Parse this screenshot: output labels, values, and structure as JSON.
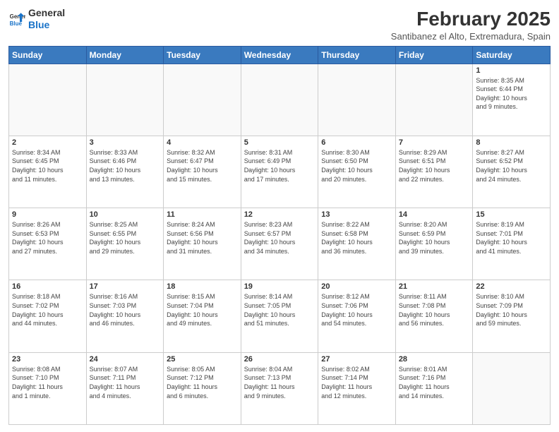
{
  "header": {
    "logo_line1": "General",
    "logo_line2": "Blue",
    "month_title": "February 2025",
    "location": "Santibanez el Alto, Extremadura, Spain"
  },
  "days_of_week": [
    "Sunday",
    "Monday",
    "Tuesday",
    "Wednesday",
    "Thursday",
    "Friday",
    "Saturday"
  ],
  "weeks": [
    [
      {
        "day": "",
        "info": ""
      },
      {
        "day": "",
        "info": ""
      },
      {
        "day": "",
        "info": ""
      },
      {
        "day": "",
        "info": ""
      },
      {
        "day": "",
        "info": ""
      },
      {
        "day": "",
        "info": ""
      },
      {
        "day": "1",
        "info": "Sunrise: 8:35 AM\nSunset: 6:44 PM\nDaylight: 10 hours\nand 9 minutes."
      }
    ],
    [
      {
        "day": "2",
        "info": "Sunrise: 8:34 AM\nSunset: 6:45 PM\nDaylight: 10 hours\nand 11 minutes."
      },
      {
        "day": "3",
        "info": "Sunrise: 8:33 AM\nSunset: 6:46 PM\nDaylight: 10 hours\nand 13 minutes."
      },
      {
        "day": "4",
        "info": "Sunrise: 8:32 AM\nSunset: 6:47 PM\nDaylight: 10 hours\nand 15 minutes."
      },
      {
        "day": "5",
        "info": "Sunrise: 8:31 AM\nSunset: 6:49 PM\nDaylight: 10 hours\nand 17 minutes."
      },
      {
        "day": "6",
        "info": "Sunrise: 8:30 AM\nSunset: 6:50 PM\nDaylight: 10 hours\nand 20 minutes."
      },
      {
        "day": "7",
        "info": "Sunrise: 8:29 AM\nSunset: 6:51 PM\nDaylight: 10 hours\nand 22 minutes."
      },
      {
        "day": "8",
        "info": "Sunrise: 8:27 AM\nSunset: 6:52 PM\nDaylight: 10 hours\nand 24 minutes."
      }
    ],
    [
      {
        "day": "9",
        "info": "Sunrise: 8:26 AM\nSunset: 6:53 PM\nDaylight: 10 hours\nand 27 minutes."
      },
      {
        "day": "10",
        "info": "Sunrise: 8:25 AM\nSunset: 6:55 PM\nDaylight: 10 hours\nand 29 minutes."
      },
      {
        "day": "11",
        "info": "Sunrise: 8:24 AM\nSunset: 6:56 PM\nDaylight: 10 hours\nand 31 minutes."
      },
      {
        "day": "12",
        "info": "Sunrise: 8:23 AM\nSunset: 6:57 PM\nDaylight: 10 hours\nand 34 minutes."
      },
      {
        "day": "13",
        "info": "Sunrise: 8:22 AM\nSunset: 6:58 PM\nDaylight: 10 hours\nand 36 minutes."
      },
      {
        "day": "14",
        "info": "Sunrise: 8:20 AM\nSunset: 6:59 PM\nDaylight: 10 hours\nand 39 minutes."
      },
      {
        "day": "15",
        "info": "Sunrise: 8:19 AM\nSunset: 7:01 PM\nDaylight: 10 hours\nand 41 minutes."
      }
    ],
    [
      {
        "day": "16",
        "info": "Sunrise: 8:18 AM\nSunset: 7:02 PM\nDaylight: 10 hours\nand 44 minutes."
      },
      {
        "day": "17",
        "info": "Sunrise: 8:16 AM\nSunset: 7:03 PM\nDaylight: 10 hours\nand 46 minutes."
      },
      {
        "day": "18",
        "info": "Sunrise: 8:15 AM\nSunset: 7:04 PM\nDaylight: 10 hours\nand 49 minutes."
      },
      {
        "day": "19",
        "info": "Sunrise: 8:14 AM\nSunset: 7:05 PM\nDaylight: 10 hours\nand 51 minutes."
      },
      {
        "day": "20",
        "info": "Sunrise: 8:12 AM\nSunset: 7:06 PM\nDaylight: 10 hours\nand 54 minutes."
      },
      {
        "day": "21",
        "info": "Sunrise: 8:11 AM\nSunset: 7:08 PM\nDaylight: 10 hours\nand 56 minutes."
      },
      {
        "day": "22",
        "info": "Sunrise: 8:10 AM\nSunset: 7:09 PM\nDaylight: 10 hours\nand 59 minutes."
      }
    ],
    [
      {
        "day": "23",
        "info": "Sunrise: 8:08 AM\nSunset: 7:10 PM\nDaylight: 11 hours\nand 1 minute."
      },
      {
        "day": "24",
        "info": "Sunrise: 8:07 AM\nSunset: 7:11 PM\nDaylight: 11 hours\nand 4 minutes."
      },
      {
        "day": "25",
        "info": "Sunrise: 8:05 AM\nSunset: 7:12 PM\nDaylight: 11 hours\nand 6 minutes."
      },
      {
        "day": "26",
        "info": "Sunrise: 8:04 AM\nSunset: 7:13 PM\nDaylight: 11 hours\nand 9 minutes."
      },
      {
        "day": "27",
        "info": "Sunrise: 8:02 AM\nSunset: 7:14 PM\nDaylight: 11 hours\nand 12 minutes."
      },
      {
        "day": "28",
        "info": "Sunrise: 8:01 AM\nSunset: 7:16 PM\nDaylight: 11 hours\nand 14 minutes."
      },
      {
        "day": "",
        "info": ""
      }
    ]
  ]
}
